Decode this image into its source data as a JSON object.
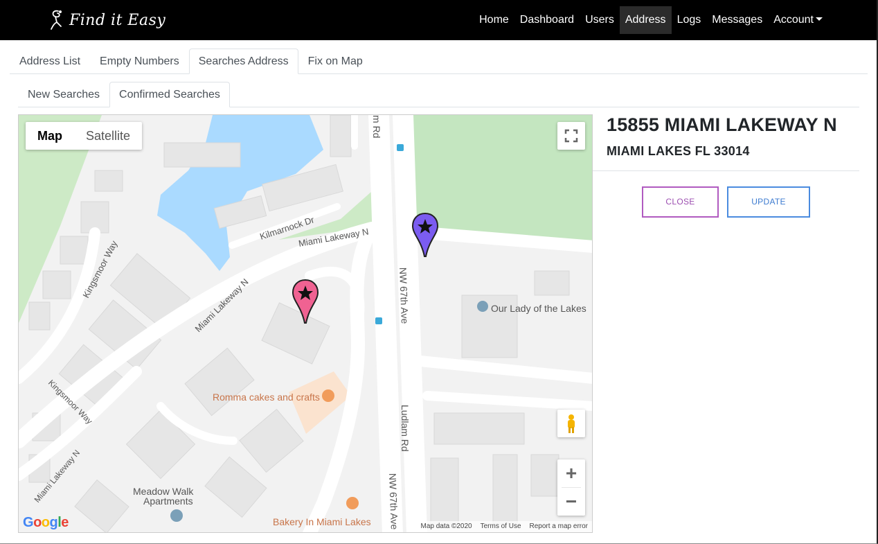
{
  "brand": {
    "name": "Find it Easy"
  },
  "nav": {
    "items": [
      {
        "label": "Home"
      },
      {
        "label": "Dashboard"
      },
      {
        "label": "Users"
      },
      {
        "label": "Address"
      },
      {
        "label": "Logs"
      },
      {
        "label": "Messages"
      },
      {
        "label": "Account"
      }
    ],
    "active": "Address"
  },
  "tabs": {
    "primary": [
      {
        "label": "Address List"
      },
      {
        "label": "Empty Numbers"
      },
      {
        "label": "Searches Address"
      },
      {
        "label": "Fix on Map"
      }
    ],
    "primary_active": "Searches Address",
    "secondary": [
      {
        "label": "New Searches"
      },
      {
        "label": "Confirmed Searches"
      }
    ],
    "secondary_active": "Confirmed Searches"
  },
  "map": {
    "type_options": [
      "Map",
      "Satellite"
    ],
    "selected_type": "Map",
    "google_logo": "Google",
    "attribution": [
      "Map data ©2020",
      "Terms of Use",
      "Report a map error"
    ],
    "zoom_in": "+",
    "zoom_out": "−",
    "labels": {
      "kilmarnock": "Kilmarnock Dr",
      "miami_lakeway_n_top": "Miami Lakeway N",
      "kingsmoor_top": "Kingsmoor Way",
      "miami_lakeway_n_mid": "Miami Lakeway N",
      "nw67_top": "NW 67th Ave",
      "our_lady": "Our Lady of the Lakes",
      "romma": "Romma cakes and crafts",
      "ludlam": "Ludlam Rd",
      "kingsmoor_bottom": "Kingsmoor Way",
      "miami_lakeway_n_bottom": "Miami Lakeway N",
      "meadow_walk_1": "Meadow Walk",
      "meadow_walk_2": "Apartments",
      "bakery": "Bakery In Miami Lakes",
      "nw67_bottom": "NW 67th Ave",
      "ludlam_top": "m Rd"
    },
    "marker_colors": {
      "purple": "#7b5cf0",
      "pink": "#f06292"
    }
  },
  "details": {
    "address_line1": "15855 MIAMI LAKEWAY N",
    "address_line2": "MIAMI LAKES FL 33014",
    "close_label": "CLOSE",
    "update_label": "UPDATE"
  }
}
